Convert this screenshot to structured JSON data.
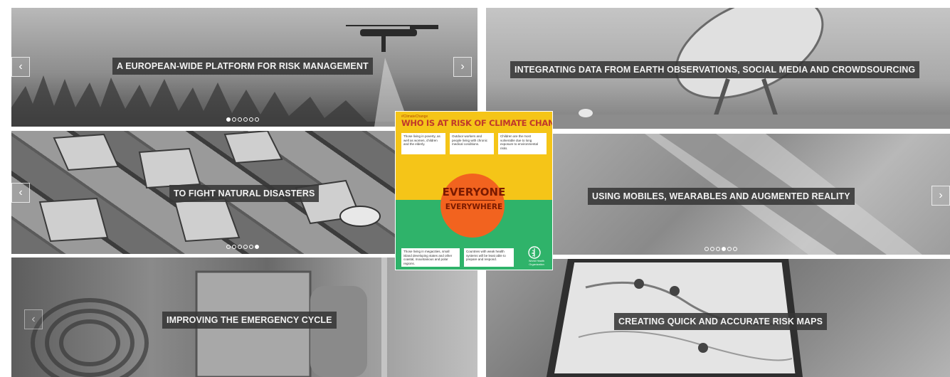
{
  "panels": [
    {
      "caption": "A EUROPEAN-WIDE PLATFORM FOR RISK MANAGEMENT",
      "slides": 6,
      "active": 0
    },
    {
      "caption": "INTEGRATING DATA FROM EARTH OBSERVATIONS, SOCIAL MEDIA AND CROWDSOURCING"
    },
    {
      "caption": "TO FIGHT NATURAL DISASTERS",
      "slides": 6,
      "active": 5
    },
    {
      "caption": "USING MOBILES, WEARABLES AND AUGMENTED REALITY",
      "slides": 6,
      "active": 3
    },
    {
      "caption": "IMPROVING THE EMERGENCY CYCLE"
    },
    {
      "caption": "CREATING QUICK AND ACCURATE RISK MAPS"
    }
  ],
  "arrows": {
    "prev": "‹",
    "next": "›"
  },
  "infographic": {
    "hashtag": "#ClimateChange",
    "title": "WHO IS AT RISK OF CLIMATE CHANGE?",
    "box1": "Those living in poverty, as well as women, children and the elderly.",
    "box2": "Outdoor workers and people living with chronic medical conditions.",
    "box3": "Children are the most vulnerable due to long exposure to environmental risks.",
    "big1": "EVERYONE",
    "big2": "EVERYWHERE",
    "box4": "Those living in megacities, small island developing states and other coastal, mountainous and polar regions.",
    "box5": "Countries with weak health systems will be least able to prepare and respond.",
    "org": "World Health Organization"
  },
  "colors": {
    "caption_bg": "#373737",
    "info_yellow": "#f5c518",
    "info_green": "#2fb36a",
    "info_orange": "#f2631f",
    "info_title": "#c0392b"
  }
}
